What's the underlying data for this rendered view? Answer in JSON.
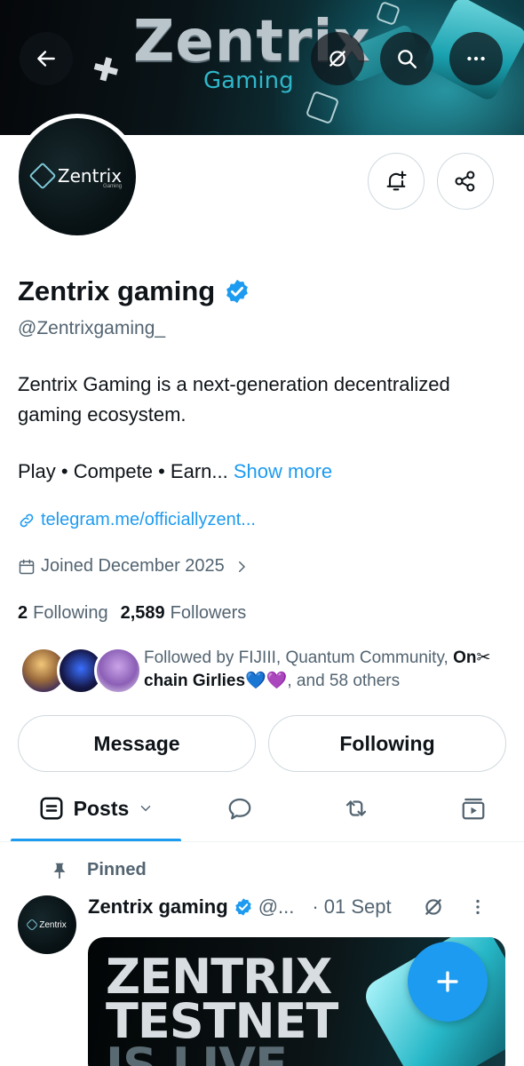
{
  "banner": {
    "title": "Zentrix",
    "subtitle": "Gaming"
  },
  "profile": {
    "avatar_logo_text": "Zentrix",
    "avatar_logo_small": "Gaming",
    "name": "Zentrix gaming",
    "handle": "@Zentrixgaming_",
    "bio_line": "Zentrix Gaming is a next-generation decentralized gaming ecosystem.",
    "bio_tagline": "Play • Compete • Earn...",
    "show_more": "Show more",
    "link": "telegram.me/officiallyzent...",
    "joined": "Joined December 2025",
    "following_count": "2",
    "following_label": "Following",
    "followers_count": "2,589",
    "followers_label": "Followers",
    "followed_by_prefix": "Followed by FIJIII, Quantum Community,",
    "followed_by_bold": "On✂chain Girlies💙💜",
    "followed_by_suffix": ", and 58 others"
  },
  "actions": {
    "message_label": "Message",
    "following_label": "Following"
  },
  "tabs": {
    "posts_label": "Posts"
  },
  "pinned_post": {
    "pinned_label": "Pinned",
    "author": "Zentrix gaming",
    "handle_truncated": "@...",
    "date": "· 01 Sept",
    "image_title_line1": "ZENTRIX",
    "image_title_line2": "TESTNET",
    "image_title_line3": "IS LIVE"
  },
  "colors": {
    "accent": "#1d9bf0",
    "text_primary": "#0f1419",
    "text_secondary": "#536471",
    "border": "#cfd9de"
  }
}
